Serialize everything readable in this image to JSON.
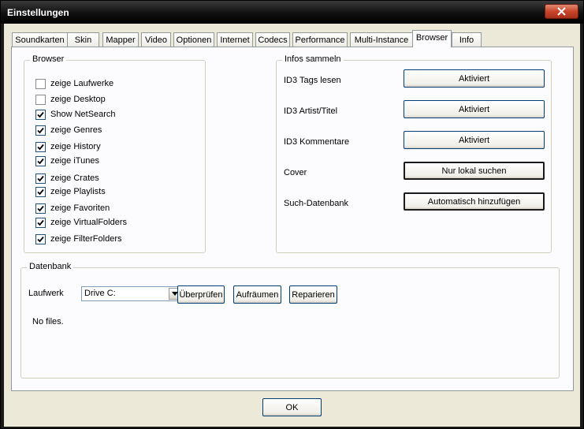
{
  "window": {
    "title": "Einstellungen"
  },
  "tabs": [
    {
      "label": "Soundkarten"
    },
    {
      "label": "Skin"
    },
    {
      "label": "Mapper"
    },
    {
      "label": "Video"
    },
    {
      "label": "Optionen"
    },
    {
      "label": "Internet"
    },
    {
      "label": "Codecs"
    },
    {
      "label": "Performance"
    },
    {
      "label": "Multi-Instance"
    },
    {
      "label": "Browser",
      "active": true
    },
    {
      "label": "Info"
    }
  ],
  "browser_group": {
    "title": "Browser",
    "items": [
      {
        "label": "zeige Laufwerke",
        "checked": false
      },
      {
        "label": "zeige Desktop",
        "checked": false
      },
      {
        "label": "Show NetSearch",
        "checked": true
      },
      {
        "label": "zeige Genres",
        "checked": true
      },
      {
        "label": "zeige History",
        "checked": true
      },
      {
        "label": "zeige iTunes",
        "checked": true
      },
      {
        "label": "zeige Crates",
        "checked": true
      },
      {
        "label": "zeige Playlists",
        "checked": true
      },
      {
        "label": "zeige Favoriten",
        "checked": true
      },
      {
        "label": "zeige VirtualFolders",
        "checked": true
      },
      {
        "label": "zeige FilterFolders",
        "checked": true
      }
    ]
  },
  "infos_group": {
    "title": "Infos sammeln",
    "rows": [
      {
        "label": "ID3 Tags lesen",
        "button": "Aktiviert"
      },
      {
        "label": "ID3 Artist/Titel",
        "button": "Aktiviert"
      },
      {
        "label": "ID3 Kommentare",
        "button": "Aktiviert"
      },
      {
        "label": "Cover",
        "button": "Nur lokal suchen"
      },
      {
        "label": "Such-Datenbank",
        "button": "Automatisch hinzufügen"
      }
    ]
  },
  "datenbank_group": {
    "title": "Datenbank",
    "drive_label": "Laufwerk",
    "drive_value": "Drive C:",
    "check_button": "Überprüfen",
    "cleanup_button": "Aufräumen",
    "repair_button": "Reparieren",
    "status": "No files."
  },
  "footer": {
    "ok_label": "OK"
  }
}
